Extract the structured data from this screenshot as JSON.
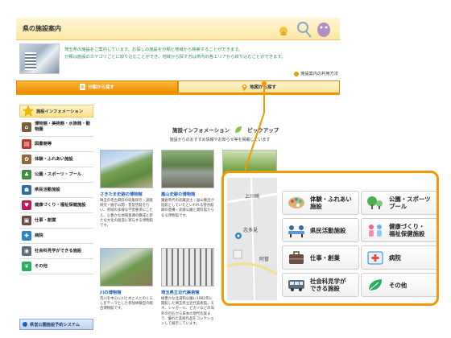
{
  "header": {
    "title": "県の施設案内"
  },
  "intro": {
    "line1": "埼玉県の施設をご案内しています。お探しの施設を分類と地域から検索することができます。",
    "line2": "分類は施設のカテゴリごとに絞り込むことができ、地域から探す方は県内の各エリアから絞り込むことができます。"
  },
  "howto_label": "施設案内の利用方法",
  "tabs": [
    {
      "label": "分類から探す"
    },
    {
      "label": "地図から探す"
    }
  ],
  "sidebar": {
    "header": "施設インフォメーション",
    "items": [
      {
        "label": "博物館・美術館・水族館・動物園",
        "icon": "museum-icon",
        "color": "#7a5b3a"
      },
      {
        "label": "図書館等",
        "icon": "library-icon",
        "color": "#c0392b"
      },
      {
        "label": "体験・ふれあい施設",
        "icon": "experience-icon",
        "color": "#8e6b3d"
      },
      {
        "label": "公園・スポーツ・プール",
        "icon": "park-icon",
        "color": "#3c8d40"
      },
      {
        "label": "県民活動施設",
        "icon": "community-icon",
        "color": "#2f6fa7"
      },
      {
        "label": "健康づくり・福祉保健施設",
        "icon": "health-icon",
        "color": "#c2185b"
      },
      {
        "label": "仕事・創業",
        "icon": "work-icon",
        "color": "#6d4c41"
      },
      {
        "label": "病院",
        "icon": "hospital-icon",
        "color": "#2e86c1"
      },
      {
        "label": "社会科見学ができる施設",
        "icon": "field-trip-icon",
        "color": "#5d6d7e"
      },
      {
        "label": "その他",
        "icon": "other-icon",
        "color": "#27ae60"
      }
    ],
    "reserve_label": "県営公園施設予約システム"
  },
  "info": {
    "title": "施設インフォメーション",
    "title_right": "ピックアップ",
    "subtitle": "施設からのおすすめ情報やお知らせ等を掲載しています"
  },
  "cards": [
    {
      "name": "さきたま史跡の博物館",
      "desc": "埼玉の考古資料の収集保存・調査研究・展示公開・普及啓発を行い、県域の多様な学習要求にこたえ、心豊かな地域意識の醸成と新たな文化の創造に寄与する博物館です。"
    },
    {
      "name": "嵐山史跡の博物館",
      "desc": "鎌倉時代の武蔵武士・畠山重忠が居館としていたといわれる菅谷館跡の遺構・史跡公園と資料館からなる博物館です。"
    },
    {
      "name": "川の博物館",
      "desc": "荒川を中心に川と水と人とのくらしをテーマとした参加体験型の総合博物館です。"
    },
    {
      "name": "埼玉県立近代美術館",
      "desc": "緑豊かな北浦和公園に1982年に開館した埼玉県立近代美術館。モネ、シャガール、ピカソなどの海外の巨匠から日本の現代作家まで、優れた美術作品をコレクションして展示しています。"
    }
  ],
  "popup": {
    "map_labels": [
      "上川崎",
      "志多見",
      "阿曽"
    ],
    "buttons": [
      {
        "label": "体験・ふれあい\n施設",
        "icon": "palette-icon"
      },
      {
        "label": "公園・スポーツ\nプール",
        "icon": "park-tree-icon"
      },
      {
        "label": "県民活動施設",
        "icon": "meeting-icon"
      },
      {
        "label": "健康づくり・\n福祉保健施設",
        "icon": "health-people-icon"
      },
      {
        "label": "仕事・創業",
        "icon": "briefcase-icon"
      },
      {
        "label": "病院",
        "icon": "hospital-icon"
      },
      {
        "label": "社会科見学が\nできる施設",
        "icon": "bus-icon"
      },
      {
        "label": "その他",
        "icon": "leaf-icon"
      }
    ]
  },
  "colors": {
    "accent": "#f29a00",
    "link": "#1f5fbf",
    "intro_text": "#2e8b57"
  }
}
